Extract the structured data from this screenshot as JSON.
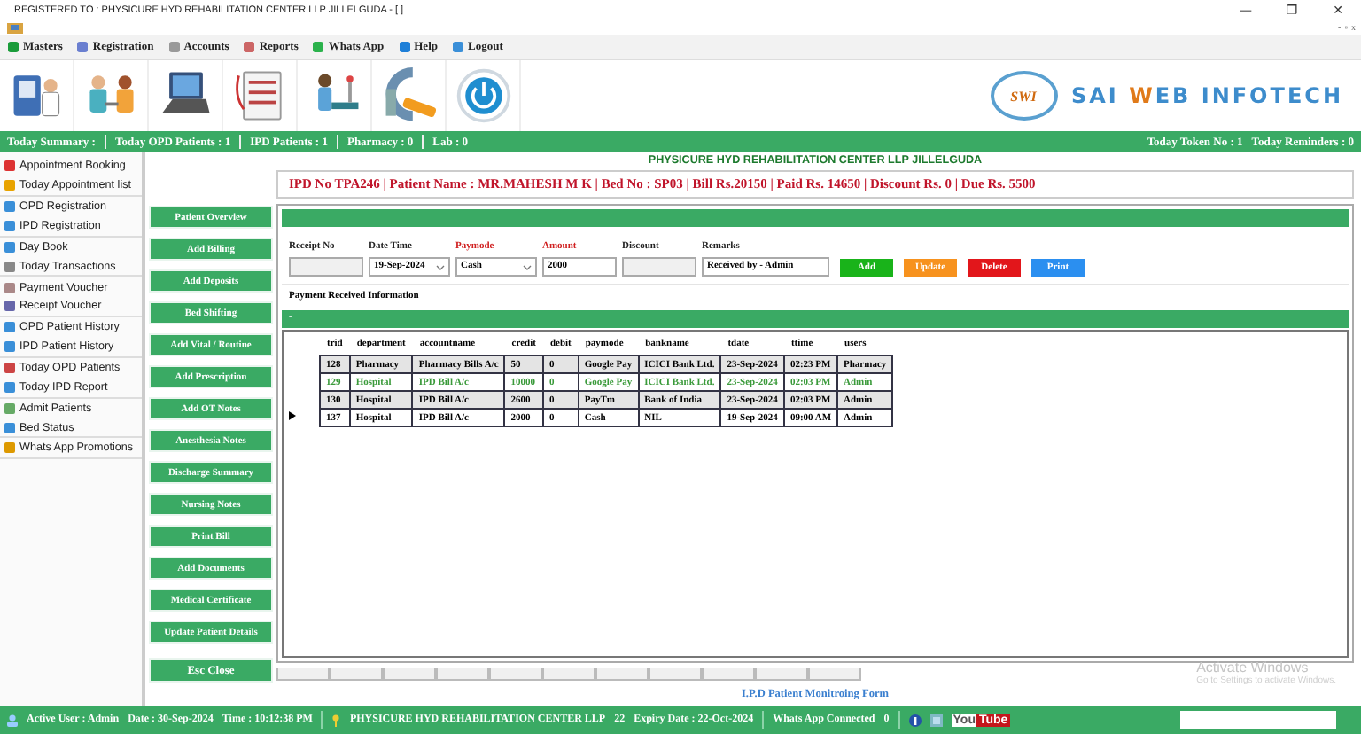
{
  "window": {
    "title": "REGISTERED TO : PHYSICURE HYD REHABILITATION CENTER LLP JILLELGUDA - [ ]",
    "controls": [
      "—",
      "❐",
      "✕"
    ],
    "mdi_controls": [
      "-",
      "▫",
      "x"
    ]
  },
  "menu": [
    {
      "label": "Masters"
    },
    {
      "label": "Registration"
    },
    {
      "label": "Accounts"
    },
    {
      "label": "Reports"
    },
    {
      "label": "Whats App"
    },
    {
      "label": "Help"
    },
    {
      "label": "Logout"
    }
  ],
  "brand": {
    "badge": "SWI",
    "name_start": "SAI ",
    "name_accent": "W",
    "name_end": "EB INFOTECH"
  },
  "summary": {
    "left": [
      "Today Summary :",
      "Today OPD Patients : 1",
      "IPD Patients : 1",
      "Pharmacy : 0",
      "Lab : 0"
    ],
    "right": [
      "Today Token No : 1",
      "Today Reminders : 0"
    ]
  },
  "sidebar": [
    {
      "label": "Appointment Booking"
    },
    {
      "label": "Today Appointment list"
    },
    {
      "label": "OPD Registration"
    },
    {
      "label": "IPD Registration"
    },
    {
      "label": "Day Book"
    },
    {
      "label": "Today Transactions"
    },
    {
      "label": "Payment Voucher"
    },
    {
      "label": "Receipt Voucher"
    },
    {
      "label": "OPD Patient History"
    },
    {
      "label": "IPD Patient History"
    },
    {
      "label": "Today OPD Patients"
    },
    {
      "label": "Today IPD Report"
    },
    {
      "label": "Admit Patients"
    },
    {
      "label": "Bed Status"
    },
    {
      "label": "Whats App Promotions"
    }
  ],
  "actions": [
    "Patient Overview",
    "Add Billing",
    "Add Deposits",
    "Bed Shifting",
    "Add Vital / Routine",
    "Add Prescription",
    "Add OT Notes",
    "Anesthesia Notes",
    "Discharge Summary",
    "Nursing Notes",
    "Print Bill",
    "Add Documents",
    "Medical Certificate",
    "Update Patient Details"
  ],
  "close_button": "Esc Close",
  "center_title": "PHYSICURE HYD REHABILITATION CENTER LLP JILLELGUDA",
  "patient_info": "IPD No TPA246 |  Patient Name : MR.MAHESH M K  |  Bed No : SP03 |  Bill Rs.20150 |  Paid Rs. 14650 |  Discount Rs. 0 |  Due Rs. 5500",
  "form": {
    "fields": [
      {
        "label": "Receipt No",
        "kind": "text",
        "required": false
      },
      {
        "label": "Date Time",
        "kind": "dropdown",
        "required": false,
        "value": "19-Sep-2024"
      },
      {
        "label": "Paymode",
        "kind": "dropdown",
        "required": true,
        "value": "Cash"
      },
      {
        "label": "Amount",
        "kind": "text",
        "required": true,
        "value": "2000"
      },
      {
        "label": "Discount",
        "kind": "text",
        "required": false
      },
      {
        "label": "Remarks",
        "kind": "text",
        "required": false,
        "value": "Received by - Admin"
      }
    ],
    "buttons": [
      {
        "label": "Add",
        "color": "#19b31a"
      },
      {
        "label": "Update",
        "color": "#f7921e"
      },
      {
        "label": "Delete",
        "color": "#e2161b"
      },
      {
        "label": "Print",
        "color": "#2b8ff0"
      }
    ]
  },
  "section_title": "Payment Received Information",
  "grid_bar": "-",
  "table": {
    "columns": [
      "trid",
      "department",
      "accountname",
      "credit",
      "debit",
      "paymode",
      "bankname",
      "tdate",
      "ttime",
      "users"
    ],
    "rows": [
      {
        "kind": "shaded",
        "selected": false,
        "cells": [
          "128",
          "Pharmacy",
          "Pharmacy Bills A/c",
          "50",
          "0",
          "Google Pay",
          "ICICI Bank Ltd.",
          "23-Sep-2024",
          "02:23 PM",
          "Pharmacy"
        ]
      },
      {
        "kind": "green",
        "selected": false,
        "cells": [
          "129",
          "Hospital",
          "IPD Bill A/c",
          "10000",
          "0",
          "Google Pay",
          "ICICI Bank Ltd.",
          "23-Sep-2024",
          "02:03 PM",
          "Admin"
        ]
      },
      {
        "kind": "shaded",
        "selected": false,
        "cells": [
          "130",
          "Hospital",
          "IPD Bill A/c",
          "2600",
          "0",
          "PayTm",
          "Bank of India",
          "23-Sep-2024",
          "02:03 PM",
          "Admin"
        ]
      },
      {
        "kind": "plain",
        "selected": true,
        "cells": [
          "137",
          "Hospital",
          "IPD Bill A/c",
          "2000",
          "0",
          "Cash",
          "NIL",
          "19-Sep-2024",
          "09:00 AM",
          "Admin"
        ]
      }
    ]
  },
  "footer_link": "I.P.D Patient Monitroing Form",
  "activation": {
    "title": "Activate Windows",
    "hint": "Go to Settings to activate Windows."
  },
  "status": {
    "user": "Active User : Admin",
    "date": "Date : 30-Sep-2024",
    "time": "Time : 10:12:38 PM",
    "center": "PHYSICURE HYD REHABILITATION CENTER LLP",
    "count": "22",
    "expiry": "Expiry Date : 22-Oct-2024",
    "whatsapp": "Whats App Connected",
    "wa_count": "0",
    "youtube_a": "You",
    "youtube_b": "Tube"
  }
}
